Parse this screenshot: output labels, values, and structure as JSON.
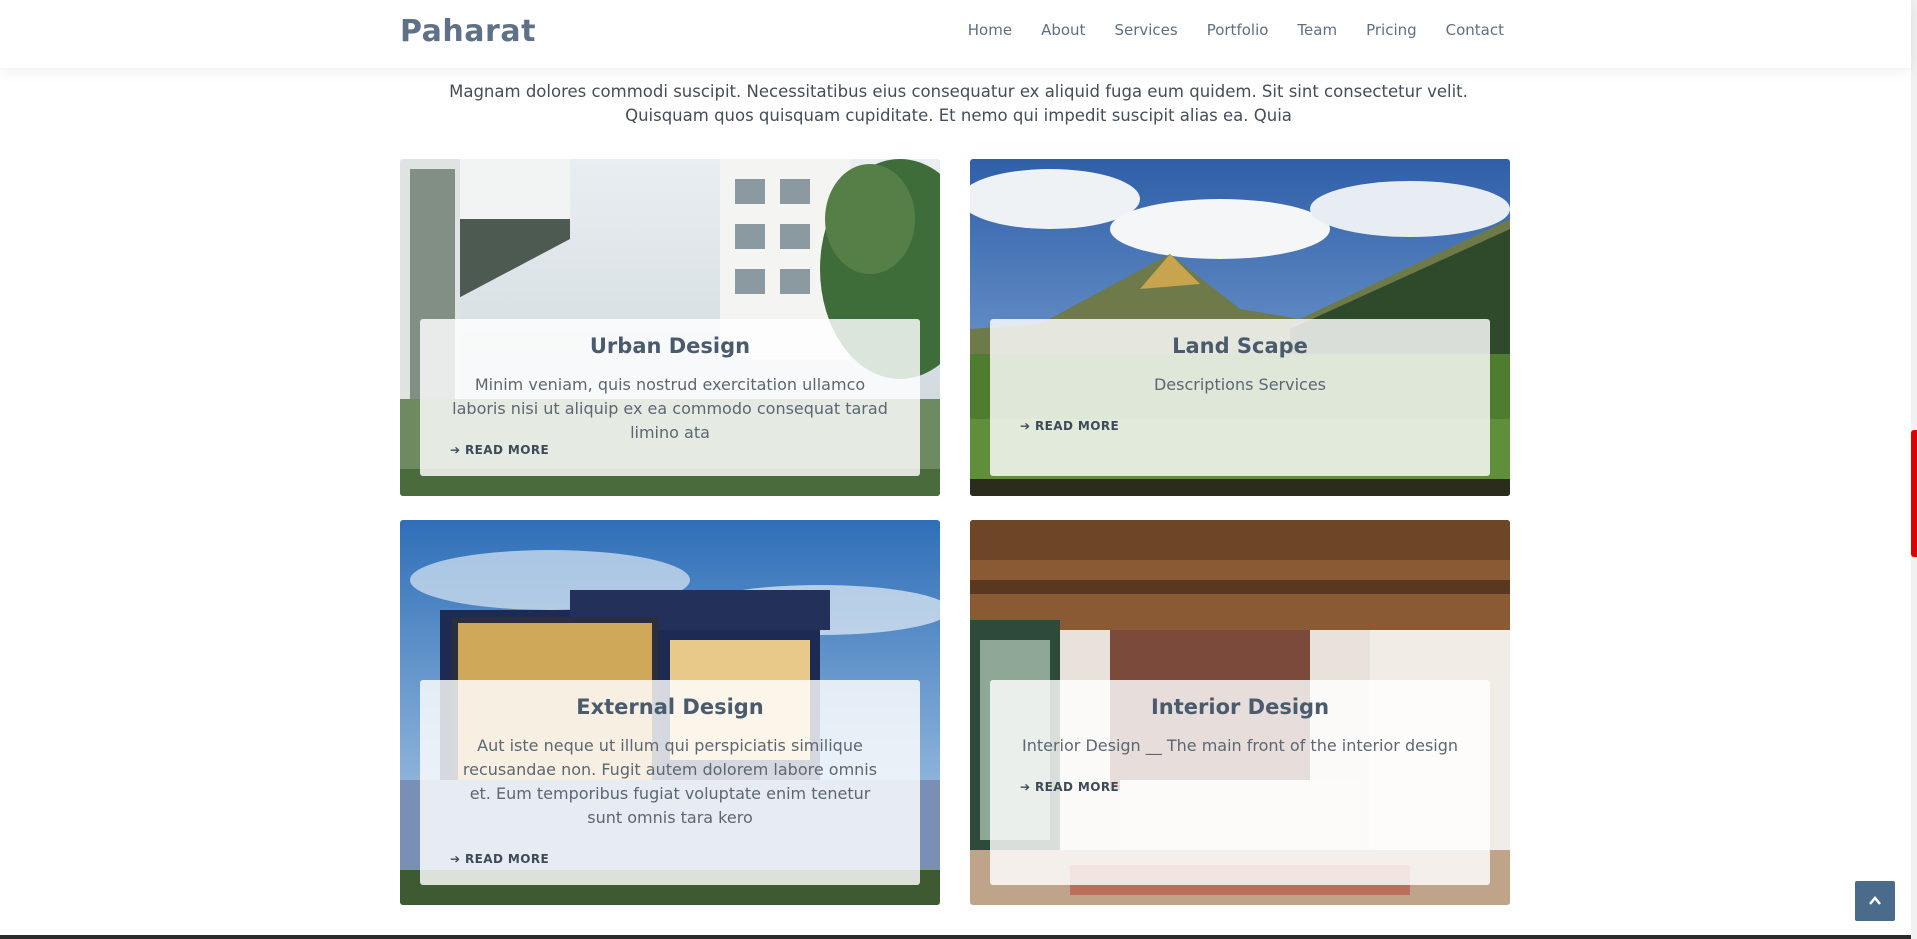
{
  "brand": "Paharat",
  "nav": [
    "Home",
    "About",
    "Services",
    "Portfolio",
    "Team",
    "Pricing",
    "Contact"
  ],
  "intro": "Magnam dolores commodi suscipit. Necessitatibus eius consequatur ex aliquid fuga eum quidem. Sit sint consectetur velit. Quisquam quos quisquam cupiditate. Et nemo qui impedit suscipit alias ea. Quia",
  "cards": [
    {
      "title": "Urban Design",
      "text": "Minim veniam, quis nostrud exercitation ullamco laboris nisi ut aliquip ex ea commodo consequat tarad limino ata",
      "link": "READ MORE"
    },
    {
      "title": "Land Scape",
      "text": "Descriptions Services",
      "link": "READ MORE"
    },
    {
      "title": "External Design",
      "text": "Aut iste neque ut illum qui perspiciatis similique recusandae non. Fugit autem dolorem labore omnis et. Eum temporibus fugiat voluptate enim tenetur sunt omnis tara kero",
      "link": "READ MORE"
    },
    {
      "title": "Interior Design",
      "text": "Interior Design __ The main front of the interior design",
      "link": "READ MORE"
    }
  ],
  "colors": {
    "accent": "#4b6b8b",
    "scroll_thumb": "#e00000"
  },
  "icons": {
    "read_more": "arrow-right-icon",
    "back_to_top": "chevron-up-icon"
  }
}
